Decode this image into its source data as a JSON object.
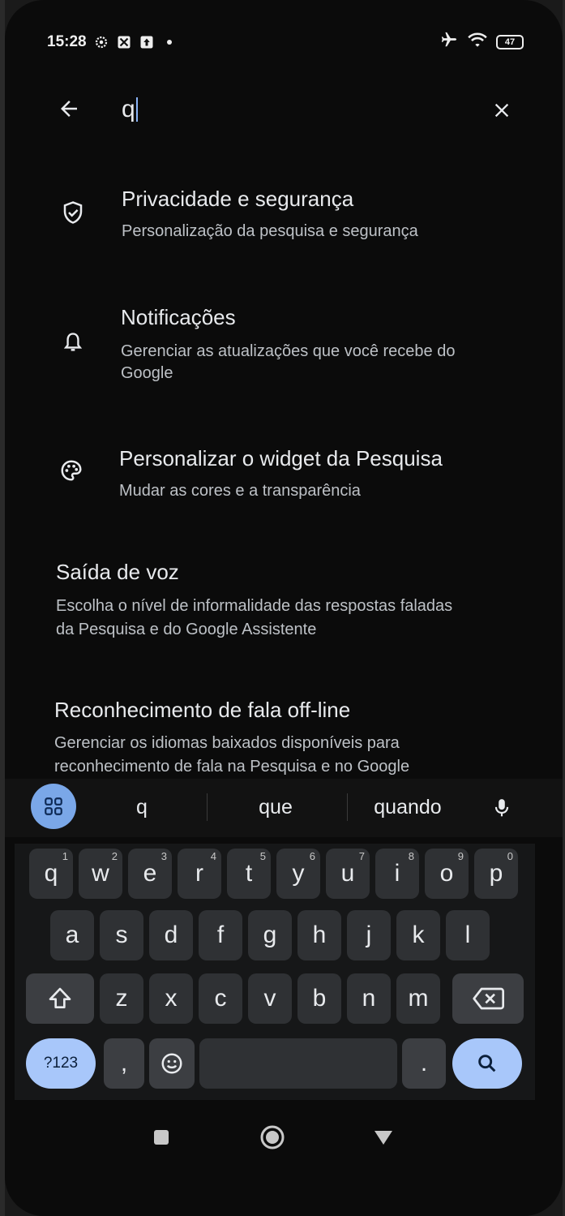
{
  "status_bar": {
    "time": "15:28",
    "battery": "47"
  },
  "search": {
    "query": "q"
  },
  "results": [
    {
      "title": "Privacidade e segurança",
      "subtitle": "Personalização da pesquisa e segurança",
      "icon": "shield-check-icon"
    },
    {
      "title": "Notificações",
      "subtitle": "Gerenciar as atualizações que você recebe do Google",
      "icon": "bell-icon"
    },
    {
      "title": "Personalizar o widget da Pesquisa",
      "subtitle": "Mudar as cores e a transparência",
      "icon": "palette-icon"
    },
    {
      "title": "Saída de voz",
      "subtitle": "Escolha o nível de informalidade das respostas faladas da Pesquisa e do Google Assistente",
      "icon": ""
    },
    {
      "title": "Reconhecimento de fala off-line",
      "subtitle": "Gerenciar os idiomas baixados disponíveis para reconhecimento de fala na Pesquisa e no Google",
      "icon": ""
    }
  ],
  "suggestions": [
    "q",
    "que",
    "quando"
  ],
  "keyboard": {
    "row1": [
      {
        "k": "q",
        "h": "1"
      },
      {
        "k": "w",
        "h": "2"
      },
      {
        "k": "e",
        "h": "3"
      },
      {
        "k": "r",
        "h": "4"
      },
      {
        "k": "t",
        "h": "5"
      },
      {
        "k": "y",
        "h": "6"
      },
      {
        "k": "u",
        "h": "7"
      },
      {
        "k": "i",
        "h": "8"
      },
      {
        "k": "o",
        "h": "9"
      },
      {
        "k": "p",
        "h": "0"
      }
    ],
    "row2": [
      "a",
      "s",
      "d",
      "f",
      "g",
      "h",
      "j",
      "k",
      "l"
    ],
    "row3": [
      "z",
      "x",
      "c",
      "v",
      "b",
      "n",
      "m"
    ],
    "symbols_label": "?123",
    "comma": ",",
    "period": "."
  },
  "colors": {
    "accent": "#8ab4f8",
    "key": "#2f3134",
    "search_key": "#a8c7fa"
  }
}
